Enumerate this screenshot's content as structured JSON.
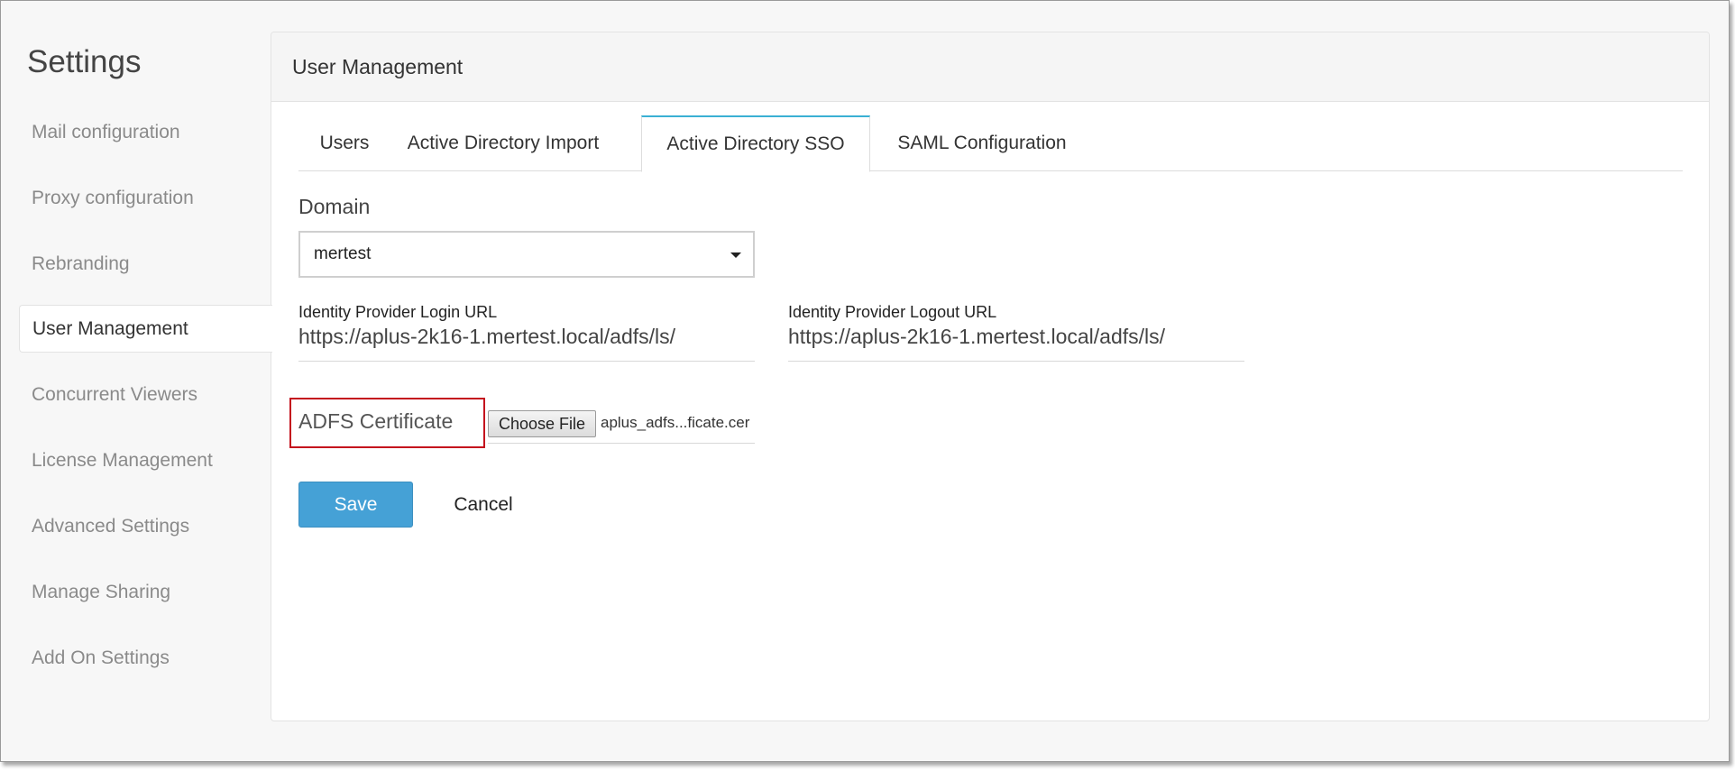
{
  "sidebar": {
    "title": "Settings",
    "items": [
      {
        "label": "Mail configuration"
      },
      {
        "label": "Proxy configuration"
      },
      {
        "label": "Rebranding"
      },
      {
        "label": "User Management",
        "active": true
      },
      {
        "label": "Concurrent Viewers"
      },
      {
        "label": "License Management"
      },
      {
        "label": "Advanced Settings"
      },
      {
        "label": "Manage Sharing"
      },
      {
        "label": "Add On Settings"
      }
    ]
  },
  "panel": {
    "title": "User Management",
    "tabs": [
      {
        "label": "Users"
      },
      {
        "label": "Active Directory Import"
      },
      {
        "label": "Active Directory SSO",
        "active": true
      },
      {
        "label": "SAML Configuration"
      }
    ]
  },
  "form": {
    "domain": {
      "label": "Domain",
      "value": "mertest",
      "icon": "caret-down-icon"
    },
    "login_url": {
      "label": "Identity Provider Login URL",
      "value": "https://aplus-2k16-1.mertest.local/adfs/ls/"
    },
    "logout_url": {
      "label": "Identity Provider Logout URL",
      "value": "https://aplus-2k16-1.mertest.local/adfs/ls/"
    },
    "certificate": {
      "label": "ADFS Certificate",
      "button": "Choose File",
      "file_name": "aplus_adfs...ficate.cer"
    },
    "save_label": "Save",
    "cancel_label": "Cancel"
  },
  "colors": {
    "accent": "#45a1d6",
    "tab_active_border": "#3ab0d4",
    "highlight": "#c4101d"
  }
}
